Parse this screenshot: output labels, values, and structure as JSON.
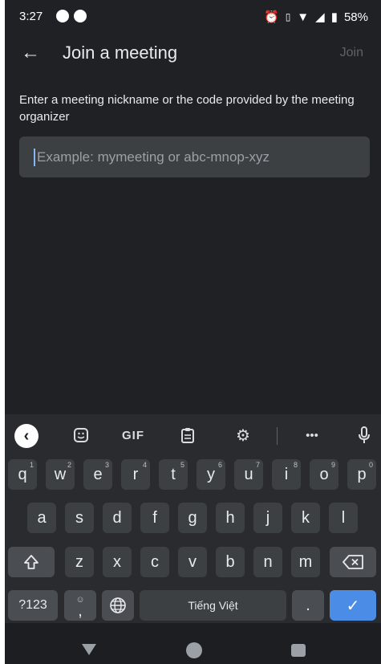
{
  "status_bar": {
    "time": "3:27",
    "battery": "58%"
  },
  "app_bar": {
    "title": "Join a meeting",
    "join_label": "Join"
  },
  "instructions": "Enter a meeting nickname or the code provided by the meeting organizer",
  "code_field": {
    "value": "",
    "placeholder": "Example: mymeeting or abc-mnop-xyz"
  },
  "keyboard": {
    "toolbar": {
      "gif_label": "GIF",
      "more_label": "•••"
    },
    "rows": [
      [
        {
          "k": "q",
          "s": "1"
        },
        {
          "k": "w",
          "s": "2"
        },
        {
          "k": "e",
          "s": "3"
        },
        {
          "k": "r",
          "s": "4"
        },
        {
          "k": "t",
          "s": "5"
        },
        {
          "k": "y",
          "s": "6"
        },
        {
          "k": "u",
          "s": "7"
        },
        {
          "k": "i",
          "s": "8"
        },
        {
          "k": "o",
          "s": "9"
        },
        {
          "k": "p",
          "s": "0"
        }
      ],
      [
        {
          "k": "a"
        },
        {
          "k": "s"
        },
        {
          "k": "d"
        },
        {
          "k": "f"
        },
        {
          "k": "g"
        },
        {
          "k": "h"
        },
        {
          "k": "j"
        },
        {
          "k": "k"
        },
        {
          "k": "l"
        }
      ],
      [
        {
          "k": "z"
        },
        {
          "k": "x"
        },
        {
          "k": "c"
        },
        {
          "k": "v"
        },
        {
          "k": "b"
        },
        {
          "k": "n"
        },
        {
          "k": "m"
        }
      ]
    ],
    "symbols_label": "?123",
    "comma_label": ",",
    "emoji_label": "☺",
    "space_label": "Tiếng Việt",
    "period_label": ".",
    "enter_label": "✓"
  },
  "colors": {
    "background": "#202124",
    "field": "#3c4043",
    "keyboard": "#2a2b2e",
    "enter_key": "#4a8ce6",
    "cursor": "#8ab4f8"
  }
}
